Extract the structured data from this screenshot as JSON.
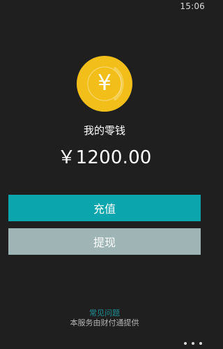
{
  "status_bar": {
    "time": "15:06"
  },
  "wallet": {
    "title": "我的零钱",
    "amount": "￥1200.00",
    "coin_symbol": "¥",
    "coin_icon": "yuan-coin-icon"
  },
  "actions": {
    "recharge_label": "充值",
    "withdraw_label": "提现"
  },
  "footer": {
    "faq_label": "常见问题",
    "provider_note": "本服务由财付通提供"
  },
  "app_bar": {
    "more_icon": "more-dots-icon"
  },
  "colors": {
    "background": "#1f1f1f",
    "accent": "#0aa5ad",
    "secondary_button": "#9fb5b5",
    "coin": "#f2bf1a",
    "faq_link": "#1e8f93"
  }
}
